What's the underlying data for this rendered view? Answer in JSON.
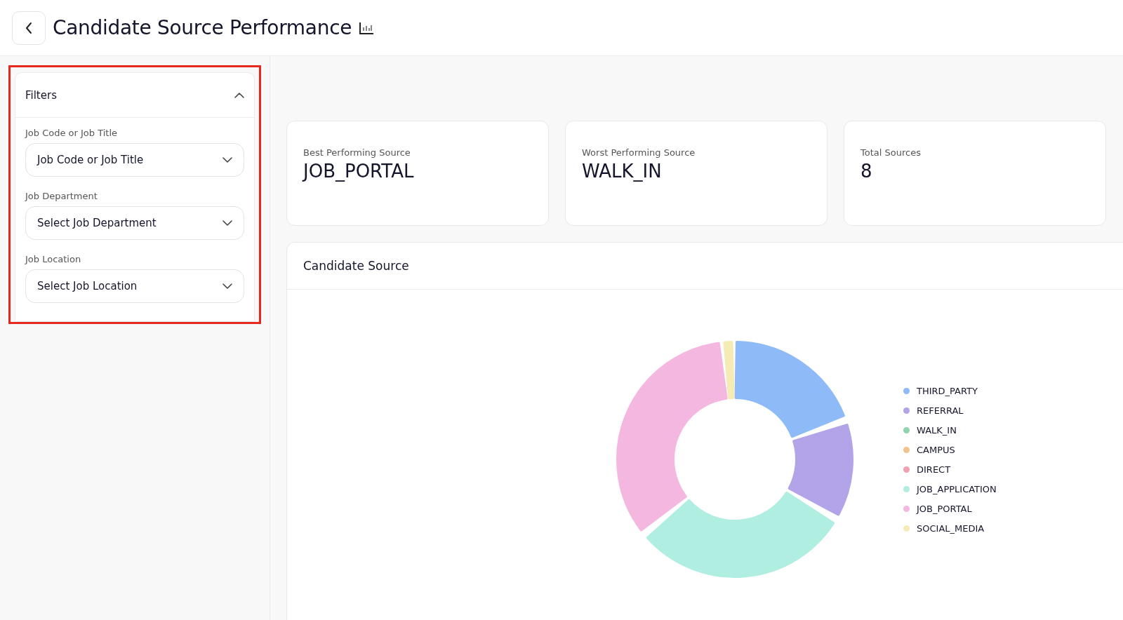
{
  "header": {
    "title": "Candidate Source Performance"
  },
  "filters": {
    "title": "Filters",
    "expanded": true,
    "fields": [
      {
        "label": "Job Code or Job Title",
        "placeholder": "Job Code or Job Title"
      },
      {
        "label": "Job Department",
        "placeholder": "Select Job Department"
      },
      {
        "label": "Job Location",
        "placeholder": "Select Job Location"
      }
    ]
  },
  "stats": [
    {
      "label": "Best Performing Source",
      "value": "JOB_PORTAL"
    },
    {
      "label": "Worst Performing Source",
      "value": "WALK_IN"
    },
    {
      "label": "Total Sources",
      "value": "8"
    }
  ],
  "candidate_source": {
    "title": "Candidate Source",
    "legend": [
      {
        "label": "THIRD_PARTY",
        "color": "#8ebaf8"
      },
      {
        "label": "REFERRAL",
        "color": "#b3a3e8"
      },
      {
        "label": "WALK_IN",
        "color": "#8fd4ad"
      },
      {
        "label": "CAMPUS",
        "color": "#f1c48f"
      },
      {
        "label": "DIRECT",
        "color": "#f0a0b0"
      },
      {
        "label": "JOB_APPLICATION",
        "color": "#b1eee2"
      },
      {
        "label": "JOB_PORTAL",
        "color": "#f4b8e0"
      },
      {
        "label": "SOCIAL_MEDIA",
        "color": "#f5ebb5"
      }
    ]
  }
}
